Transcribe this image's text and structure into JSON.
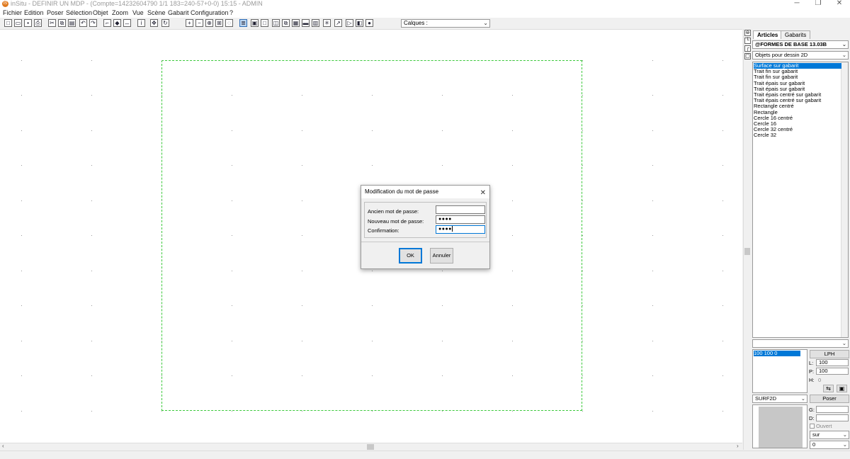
{
  "window": {
    "app_icon": "insitu-logo-icon",
    "title": "inSitu - DEFINIR UN MDP - (Compte=14232604790 1/1 183=240-57+0-0) 15:15 - ADMIN",
    "minimize": "─",
    "restore": "❐",
    "close": "✕"
  },
  "menu": {
    "items": [
      "Fichier",
      "Edition",
      "Poser",
      "Sélection",
      "Objet",
      "Zoom",
      "Vue",
      "Scène",
      "Gabarit",
      "Configuration",
      "?"
    ]
  },
  "toolbar": {
    "calques_label": "Calques :",
    "calques_arrow": "⌄",
    "icons": [
      "new-file-icon",
      "open-folder-icon",
      "save-icon",
      "print-icon",
      "cut-icon",
      "copy-icon",
      "paste-icon",
      "undo-icon",
      "redo-icon",
      "stairs-icon",
      "paint-icon",
      "measure-icon",
      "move-icon",
      "info-icon",
      "rotate-icon",
      "zoom-in-icon",
      "zoom-out-icon",
      "zoom-fit-icon",
      "zoom-window-icon",
      "zoom-previous-icon",
      "layers-icon",
      "select-icon",
      "rectangle-icon",
      "cube-icon",
      "copy-object-icon",
      "box-icon",
      "car-icon",
      "wall-icon",
      "light-icon",
      "pick-icon",
      "flag-icon",
      "mirror-icon",
      "eye-icon"
    ],
    "glyphs": [
      "□",
      "▭",
      "▪",
      "⎙",
      "✂",
      "⧉",
      "▤",
      "↶",
      "↷",
      "⌐",
      "◆",
      "↔",
      "✥",
      "i",
      "↻",
      "+",
      "−",
      "⊕",
      "⊞",
      "◌",
      "≣",
      "▣",
      "□",
      "◫",
      "⧉",
      "▦",
      "▬",
      "▥",
      "✳",
      "↗",
      "▷",
      "◧",
      "●"
    ]
  },
  "canvas": {
    "frame_color": "#3bc93b"
  },
  "vertical_toolbar": {
    "glyphs": [
      "⊜",
      "└",
      "┌",
      "▢"
    ]
  },
  "panel": {
    "tabs": [
      "Articles",
      "Gabarits"
    ],
    "library": "@FORMES DE BASE 13.03B",
    "category": "Objets pour dessin 2D",
    "combo_arrow": "⌄",
    "articles": [
      "Surface sur gabarit",
      "Trait fin sur gabarit",
      "Trait fin sur gabarit",
      "Trait épais sur gabarit",
      "Trait épais sur gabarit",
      "Trait épais centré sur gabarit",
      "Trait épais centré sur gabarit",
      "Rectangle centré",
      "Rectangle",
      "Cercle 16 centré",
      "Cercle 16",
      "Cercle 32 centré",
      "Cercle 32"
    ],
    "selected_index": 0,
    "dims_item": "100  100    0",
    "lph_label": "LPH",
    "l_label": "L:",
    "l_value": "100",
    "p_label": "P:",
    "p_value": "100",
    "h_label": "H:",
    "h_value": "0",
    "type_combo": "SURF2D",
    "poser_label": "Poser",
    "g_label": "G:",
    "d_label": "D:",
    "ouvert_label": "Ouvert",
    "sur_value": "sur",
    "zero_value": "0"
  },
  "dialog": {
    "title": "Modification du mot de passe",
    "close": "✕",
    "old_label": "Ancien mot de passe:",
    "old_value": "",
    "new_label": "Nouveau mot de passe:",
    "new_value": "●●●●",
    "confirm_label": "Confirmation:",
    "confirm_value": "●●●●",
    "ok_label": "OK",
    "cancel_label": "Annuler"
  }
}
